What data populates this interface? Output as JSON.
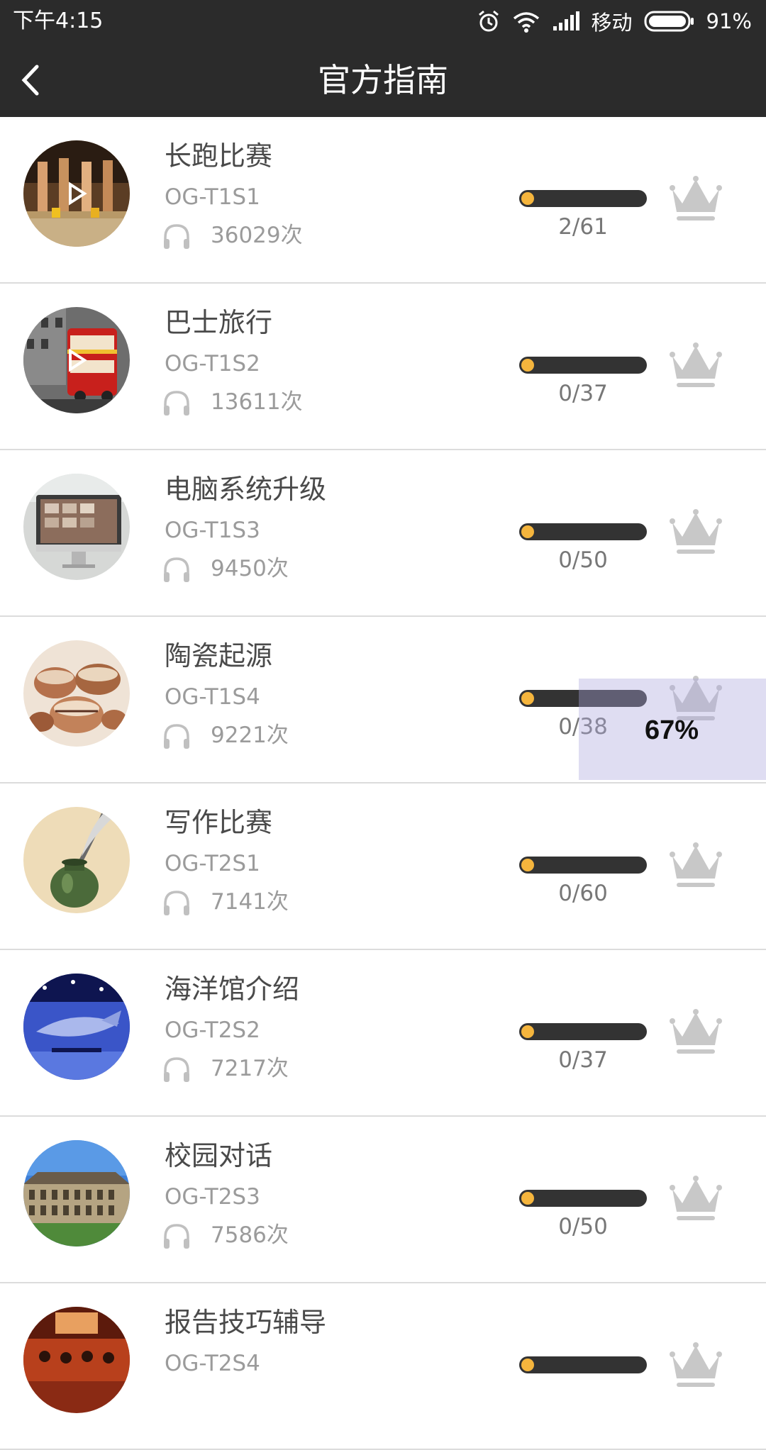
{
  "status_bar": {
    "time": "下午4:15",
    "carrier": "移动",
    "battery_percent": "91%",
    "icons": [
      "alarm-icon",
      "wifi-icon",
      "signal-icon",
      "battery-icon"
    ]
  },
  "app_bar": {
    "title": "官方指南",
    "back_icon": "chevron-left-icon"
  },
  "colors": {
    "bar_bg": "#2b2b2b",
    "progress_track": "#333333",
    "progress_fill": "#f5b53d",
    "crown": "#c8c8c8"
  },
  "items": [
    {
      "name": "长跑比赛",
      "code": "OG-T1S1",
      "plays": "36029次",
      "progress": "2/61",
      "completed": 2,
      "total": 61
    },
    {
      "name": "巴士旅行",
      "code": "OG-T1S2",
      "plays": "13611次",
      "progress": "0/37",
      "completed": 0,
      "total": 37
    },
    {
      "name": "电脑系统升级",
      "code": "OG-T1S3",
      "plays": "9450次",
      "progress": "0/50",
      "completed": 0,
      "total": 50
    },
    {
      "name": "陶瓷起源",
      "code": "OG-T1S4",
      "plays": "9221次",
      "progress": "0/38",
      "completed": 0,
      "total": 38
    },
    {
      "name": "写作比赛",
      "code": "OG-T2S1",
      "plays": "7141次",
      "progress": "0/60",
      "completed": 0,
      "total": 60
    },
    {
      "name": "海洋馆介绍",
      "code": "OG-T2S2",
      "plays": "7217次",
      "progress": "0/37",
      "completed": 0,
      "total": 37
    },
    {
      "name": "校园对话",
      "code": "OG-T2S3",
      "plays": "7586次",
      "progress": "0/50",
      "completed": 0,
      "total": 50
    },
    {
      "name": "报告技巧辅导",
      "code": "OG-T2S4",
      "plays": "",
      "progress": "",
      "completed": 0,
      "total": 0
    }
  ],
  "overlay": {
    "text": "67%"
  }
}
